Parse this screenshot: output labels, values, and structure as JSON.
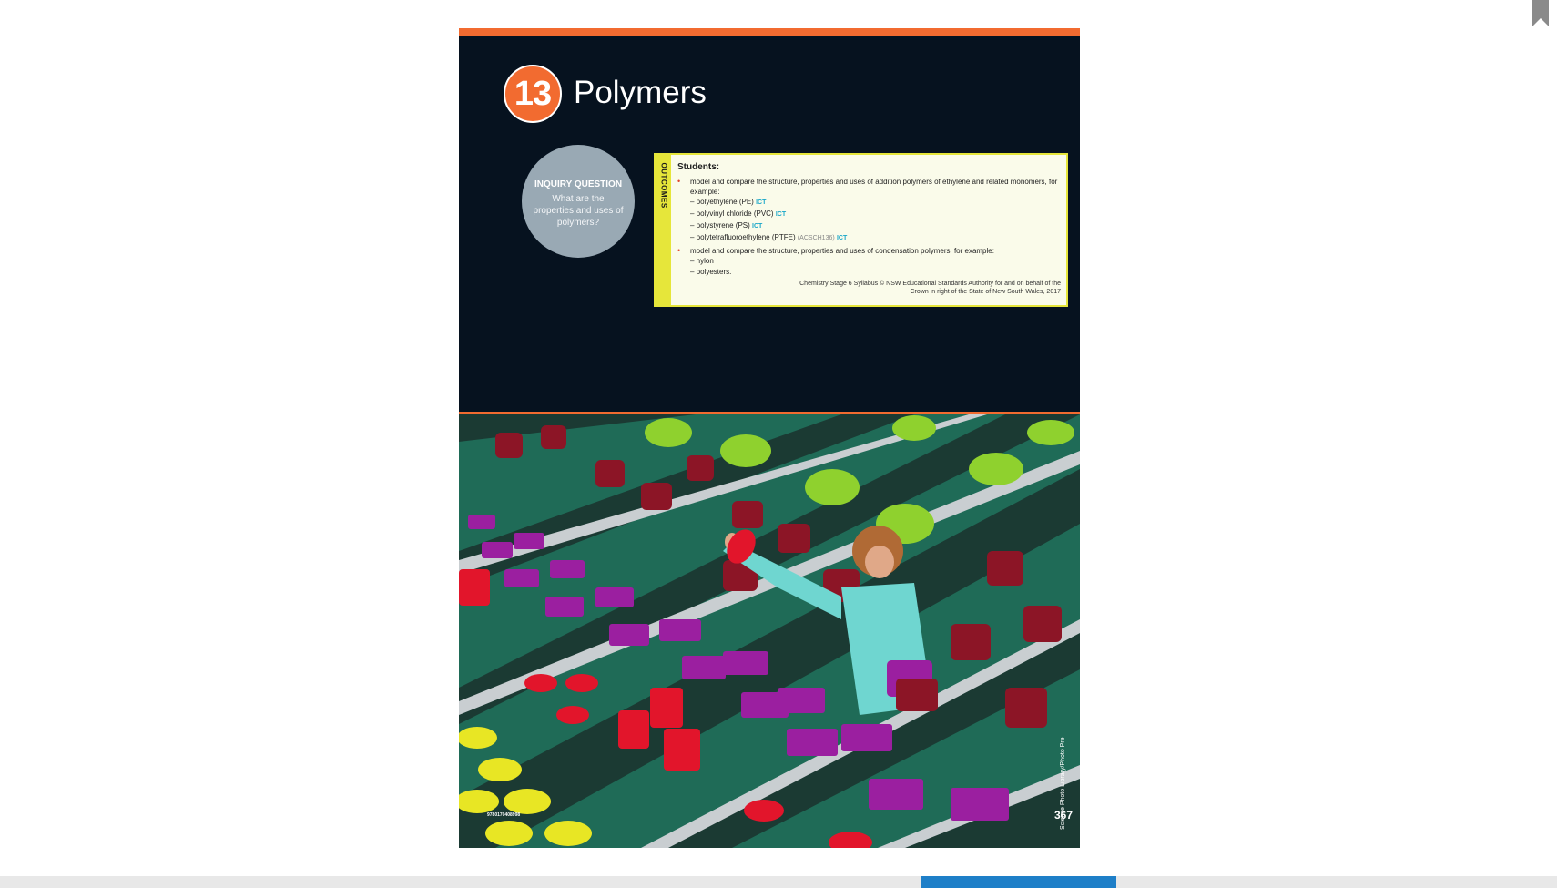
{
  "chapter": {
    "number": "13",
    "title": "Polymers"
  },
  "inquiry": {
    "heading": "INQUIRY QUESTION",
    "question": "What are the properties and uses of polymers?"
  },
  "outcomes": {
    "tab_label": "OUTCOMES",
    "intro": "Students:",
    "bullet1": "model and compare the structure, properties and uses of addition polymers of ethylene and related monomers, for example:",
    "bullet1_items": [
      {
        "text": "– polyethylene (PE)",
        "code": "",
        "tag": "ICT"
      },
      {
        "text": "– polyvinyl chloride (PVC)",
        "code": "",
        "tag": "ICT"
      },
      {
        "text": "– polystyrene (PS)",
        "code": "",
        "tag": "ICT"
      },
      {
        "text": "– polytetrafluoroethylene (PTFE)",
        "code": "(ACSCH136)",
        "tag": "ICT"
      }
    ],
    "bullet2": "model and compare the structure, properties and uses of condensation polymers, for example:",
    "bullet2_items": [
      "– nylon",
      "– polyesters."
    ],
    "credit": "Chemistry Stage 6 Syllabus © NSW Educational Standards Authority for and on behalf of the Crown in right of the State of New South Wales, 2017"
  },
  "photo": {
    "credit": "Science Photo Library/Photo Pre",
    "isbn": "9780170408998"
  },
  "page_number": "367",
  "colors": {
    "accent": "#f26b30",
    "page_bg": "#06121f",
    "outcomes_border": "#e6e63a",
    "ict": "#19a7c9",
    "scroll_thumb": "#1e7fc8"
  },
  "icons": {
    "bookmark": "bookmark-icon"
  }
}
